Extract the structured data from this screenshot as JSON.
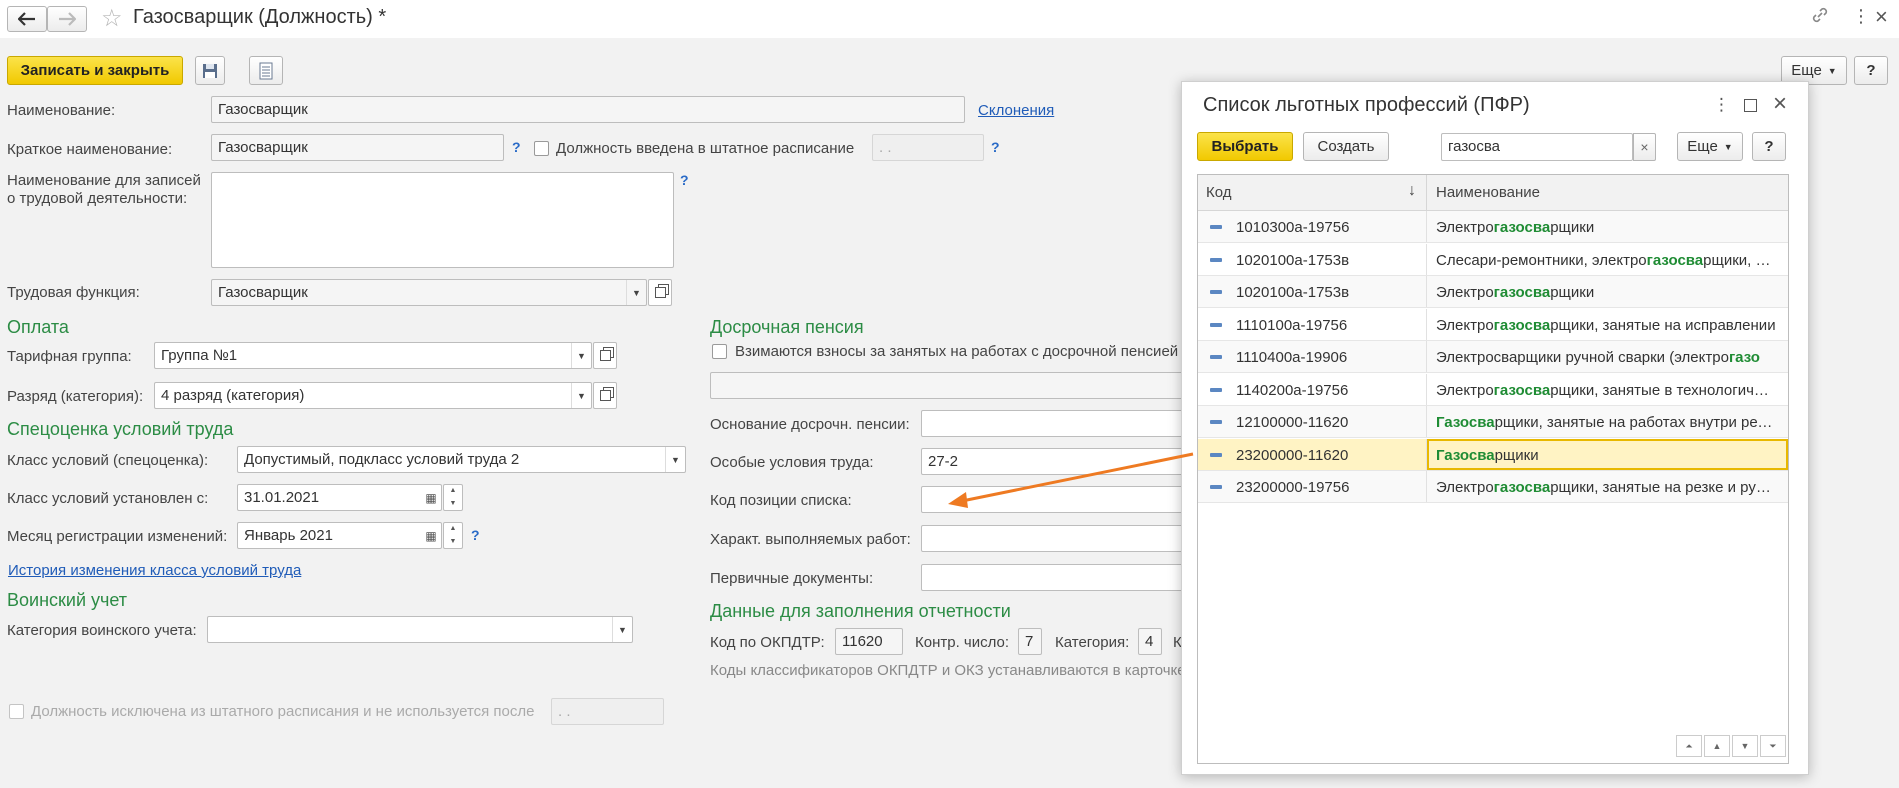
{
  "window": {
    "title": "Газосварщик (Должность) *",
    "more_label": "Еще",
    "help_label": "?"
  },
  "toolbar": {
    "save_close_label": "Записать и закрыть"
  },
  "form": {
    "name_label": "Наименование:",
    "name_value": "Газосварщик",
    "declensions_link": "Склонения",
    "short_name_label": "Краткое наименование:",
    "short_name_value": "Газосварщик",
    "in_staff_label": "Должность введена в штатное расписание",
    "in_staff_date": " .  .",
    "labor_records_label_1": "Наименование для записей",
    "labor_records_label_2": "о трудовой деятельности:",
    "labor_function_label": "Трудовая функция:",
    "labor_function_value": "Газосварщик",
    "q_mark": "?"
  },
  "payment": {
    "title": "Оплата",
    "tariff_label": "Тарифная группа:",
    "tariff_value": "Группа №1",
    "grade_label": "Разряд (категория):",
    "grade_value": "4 разряд (категория)"
  },
  "special_eval": {
    "title": "Спецоценка условий труда",
    "class_label": "Класс условий (спецоценка):",
    "class_value": "Допустимый, подкласс условий труда 2",
    "since_label": "Класс условий установлен с:",
    "since_value": "31.01.2021",
    "month_label": "Месяц регистрации изменений:",
    "month_value": "Январь 2021",
    "history_link": "История изменения класса условий труда"
  },
  "military": {
    "title": "Воинский учет",
    "category_label": "Категория воинского учета:",
    "category_value": ""
  },
  "excluded": {
    "label": "Должность исключена из штатного расписания и не используется после",
    "date": " .  ."
  },
  "early_pension": {
    "title": "Досрочная пенсия",
    "contributions_label": "Взимаются взносы за занятых на работах с досрочной пенсией",
    "basis_label": "Основание досрочн. пенсии:",
    "special_cond_label": "Особые условия труда:",
    "special_cond_value": "27-2",
    "list_code_label": "Код позиции списка:",
    "work_char_label": "Характ. выполняемых работ:",
    "primary_docs_label": "Первичные документы:"
  },
  "reporting": {
    "title": "Данные для заполнения отчетности",
    "okpdtr_label": "Код по ОКПДТР:",
    "okpdtr_value": "11620",
    "control_label": "Контр. число:",
    "control_value": "7",
    "category_label": "Категория:",
    "category_value": "4",
    "k_label": "К",
    "note": "Коды классификаторов ОКПДТР и ОКЗ устанавливаются в карточке"
  },
  "dialog": {
    "title": "Список льготных профессий (ПФР)",
    "select_label": "Выбрать",
    "create_label": "Создать",
    "search_value": "газосва",
    "clear_label": "×",
    "more_label": "Еще",
    "help_label": "?",
    "col_code": "Код",
    "col_name": "Наименование",
    "sort_arrow": "↓",
    "rows": [
      {
        "code": "1010300а-19756",
        "pre": "Электро",
        "hl": "газосва",
        "post": "рщики"
      },
      {
        "code": "1020100а-1753в",
        "pre": "Слесари-ремонтники, электро",
        "hl": "газосва",
        "post": "рщики, занятые на"
      },
      {
        "code": "1020100а-1753в",
        "pre": "Электро",
        "hl": "газосва",
        "post": "рщики"
      },
      {
        "code": "1110100а-19756",
        "pre": "Электро",
        "hl": "газосва",
        "post": "рщики, занятые на исправлении"
      },
      {
        "code": "1110400а-19906",
        "pre": "Электросварщики ручной сварки (электро",
        "hl": "газо",
        "post": ""
      },
      {
        "code": "1140200а-19756",
        "pre": "Электро",
        "hl": "газосва",
        "post": "рщики, занятые в технологическом"
      },
      {
        "code": "12100000-11620",
        "pre": "",
        "hl": "Газосва",
        "post": "рщики, занятые на работах внутри резервуаров"
      },
      {
        "code": "23200000-11620",
        "pre": "",
        "hl": "Газосва",
        "post": "рщики"
      },
      {
        "code": "23200000-19756",
        "pre": "Электро",
        "hl": "газосва",
        "post": "рщики, занятые на резке и ручной"
      }
    ],
    "selected_index": 7
  }
}
